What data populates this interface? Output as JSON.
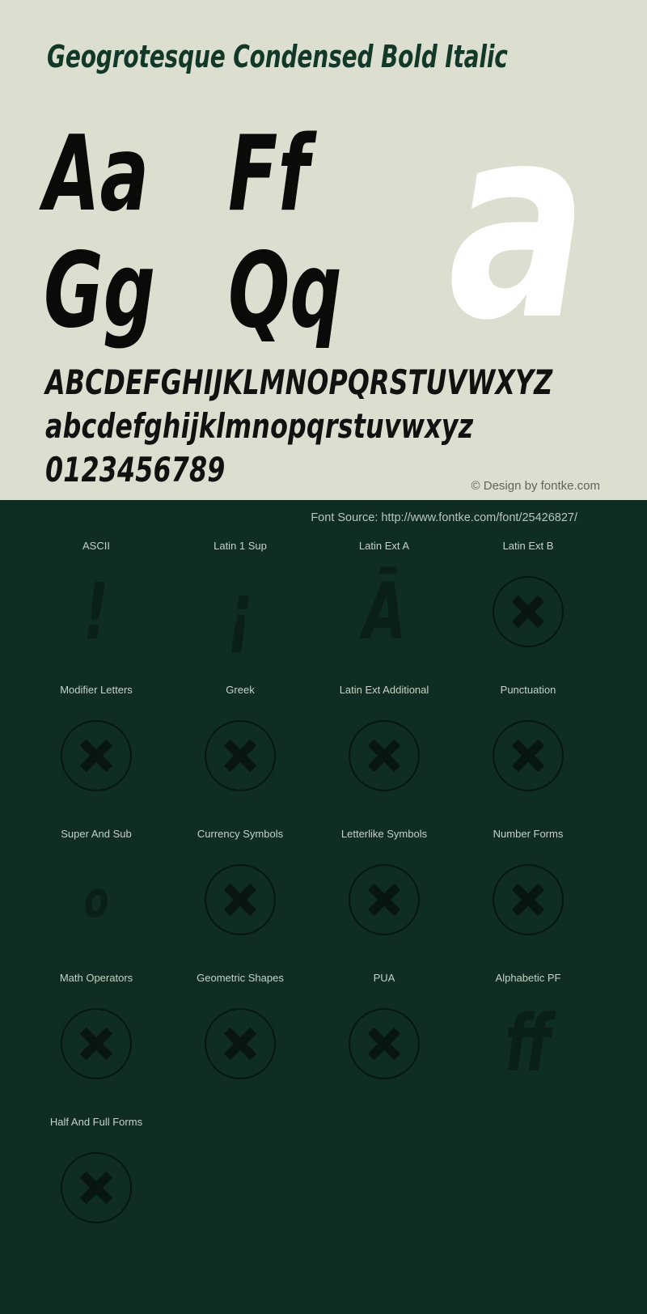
{
  "specimen": {
    "title": "Geogrotesque Condensed Bold Italic",
    "background_color": "#dcdfd0",
    "title_color": "#123828",
    "glyph_pairs": [
      [
        "Aa",
        "Ff"
      ],
      [
        "Gg",
        "Qq"
      ]
    ],
    "feature_letter": "a",
    "feature_letter_color": "#ffffff",
    "alphabet_uppercase": "ABCDEFGHIJKLMNOPQRSTUVWXYZ",
    "alphabet_lowercase": "abcdefghijklmnopqrstuvwxyz",
    "digits": "0123456789",
    "copyright": "© Design by fontke.com"
  },
  "coverage": {
    "background_color": "#0f2d23",
    "font_source": "Font Source: http://www.fontke.com/font/25426827/",
    "unsupported_icon": "x-circle-icon",
    "blocks": [
      {
        "label": "ASCII",
        "sample": "!",
        "supported": true,
        "size": "large"
      },
      {
        "label": "Latin 1 Sup",
        "sample": "¡",
        "supported": true,
        "size": "large"
      },
      {
        "label": "Latin Ext A",
        "sample": "Ā",
        "supported": true,
        "size": "large"
      },
      {
        "label": "Latin Ext B",
        "sample": "",
        "supported": false,
        "size": "large"
      },
      {
        "label": "Modifier Letters",
        "sample": "",
        "supported": false,
        "size": "large"
      },
      {
        "label": "Greek",
        "sample": "",
        "supported": false,
        "size": "large"
      },
      {
        "label": "Latin Ext Additional",
        "sample": "",
        "supported": false,
        "size": "large"
      },
      {
        "label": "Punctuation",
        "sample": "",
        "supported": false,
        "size": "large"
      },
      {
        "label": "Super And Sub",
        "sample": "o",
        "supported": true,
        "size": "small"
      },
      {
        "label": "Currency Symbols",
        "sample": "",
        "supported": false,
        "size": "large"
      },
      {
        "label": "Letterlike Symbols",
        "sample": "",
        "supported": false,
        "size": "large"
      },
      {
        "label": "Number Forms",
        "sample": "",
        "supported": false,
        "size": "large"
      },
      {
        "label": "Math Operators",
        "sample": "",
        "supported": false,
        "size": "large"
      },
      {
        "label": "Geometric Shapes",
        "sample": "",
        "supported": false,
        "size": "large"
      },
      {
        "label": "PUA",
        "sample": "",
        "supported": false,
        "size": "large"
      },
      {
        "label": "Alphabetic PF",
        "sample": "ff",
        "supported": true,
        "size": "large"
      },
      {
        "label": "Half And Full Forms",
        "sample": "",
        "supported": false,
        "size": "large"
      }
    ]
  }
}
